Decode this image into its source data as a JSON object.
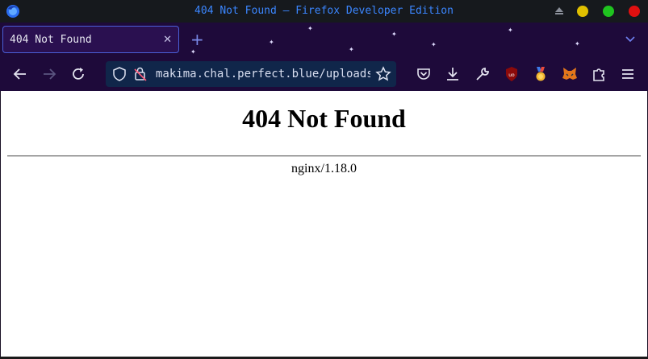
{
  "window": {
    "title": "404 Not Found — Firefox Developer Edition",
    "controls": {
      "minimize_color": "#e0c000",
      "maximize_color": "#1fc41f",
      "close_color": "#e01010"
    }
  },
  "tabs": [
    {
      "label": "404 Not Found",
      "active": true
    }
  ],
  "toolbar": {
    "url": "makima.chal.perfect.blue/uploads/"
  },
  "icons": {
    "app": "firefox-logo-icon",
    "back": "back-arrow-icon",
    "forward": "forward-arrow-icon",
    "reload": "reload-icon",
    "tracking": "shield-icon",
    "security": "insecure-lock-icon",
    "bookmark": "star-icon",
    "extensions": [
      "pocket-icon",
      "download-icon",
      "wrench-icon",
      "ublock-origin-icon",
      "medal-icon",
      "metamask-fox-icon",
      "puzzle-icon",
      "hamburger-menu-icon"
    ]
  },
  "page": {
    "heading": "404 Not Found",
    "server": "nginx/1.18.0"
  },
  "colors": {
    "accent": "#3b86ff",
    "toolbar_bg": "#1e0a3a",
    "urlbar_bg": "#10264a"
  }
}
